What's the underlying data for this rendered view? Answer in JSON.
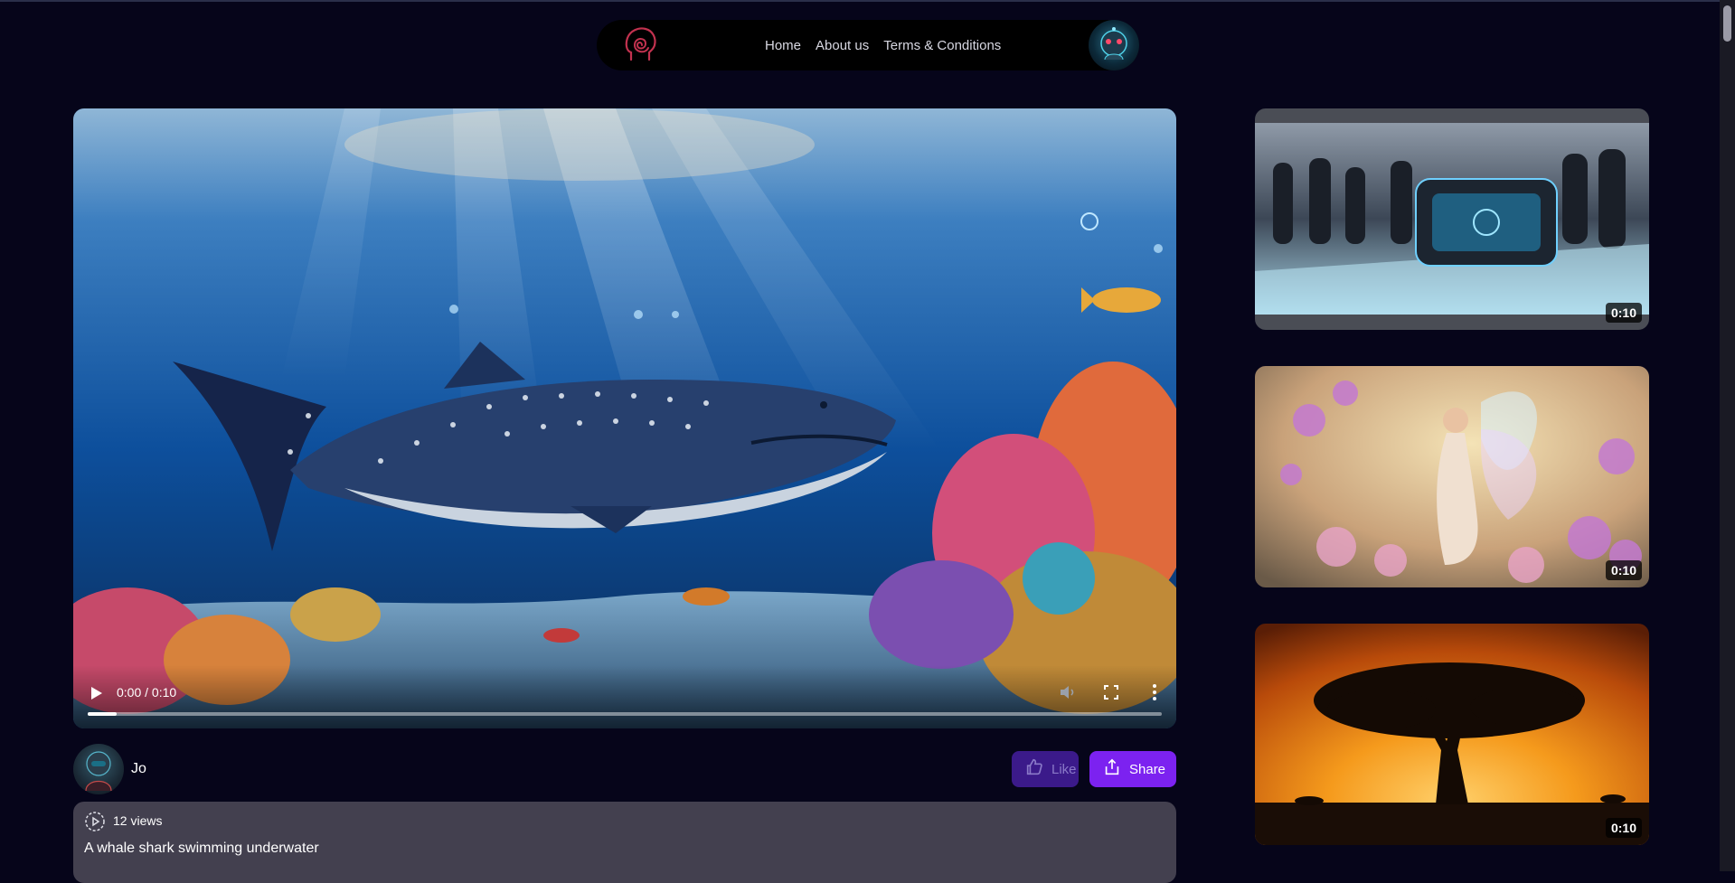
{
  "nav": {
    "links": [
      "Home",
      "About us",
      "Terms & Conditions"
    ]
  },
  "player": {
    "time": "0:00 / 0:10",
    "progress": 0.027
  },
  "author": {
    "name": "Jo"
  },
  "actions": {
    "like_label": "Like",
    "share_label": "Share"
  },
  "video": {
    "views": "12 views",
    "description": "A whale shark swimming underwater"
  },
  "sidebar": {
    "videos": [
      {
        "duration": "0:10",
        "subject": "futuristic device on glass table"
      },
      {
        "duration": "0:10",
        "subject": "fairy in flower field"
      },
      {
        "duration": "0:10",
        "subject": "tree silhouette at sunset"
      }
    ]
  },
  "colors": {
    "background": "#06051a",
    "share_button": "#7c22f0",
    "like_button": "#3b1a8a",
    "info_card": "#43404f"
  }
}
